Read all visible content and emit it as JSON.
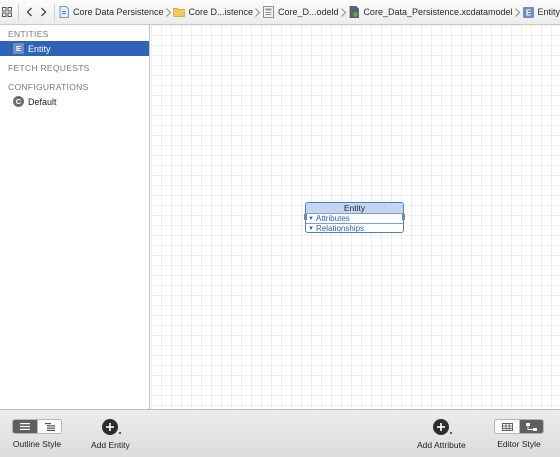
{
  "jumpbar": {
    "crumbs": [
      {
        "label": "Core Data Persistence",
        "icon": "project-file-icon"
      },
      {
        "label": "Core D...istence",
        "icon": "folder-icon"
      },
      {
        "label": "Core_D...odeld",
        "icon": "model-bundle-icon"
      },
      {
        "label": "Core_Data_Persistence.xcdatamodel",
        "icon": "datamodel-file-icon"
      },
      {
        "label": "Entity",
        "icon": "entity-e-icon"
      }
    ]
  },
  "sidebar": {
    "entities_header": "ENTITIES",
    "entities": [
      {
        "badge": "E",
        "label": "Entity",
        "selected": true
      }
    ],
    "fetch_header": "FETCH REQUESTS",
    "config_header": "CONFIGURATIONS",
    "configurations": [
      {
        "badge": "C",
        "label": "Default"
      }
    ]
  },
  "entity_box": {
    "title": "Entity",
    "sections": [
      "Attributes",
      "Relationships"
    ]
  },
  "toolbar": {
    "outline_style": "Outline Style",
    "add_entity": "Add Entity",
    "add_attribute": "Add Attribute",
    "editor_style": "Editor Style"
  },
  "colors": {
    "selection": "#2f62b9",
    "entity_header": "#c4d6ef",
    "entity_border": "#4f7fc4"
  }
}
